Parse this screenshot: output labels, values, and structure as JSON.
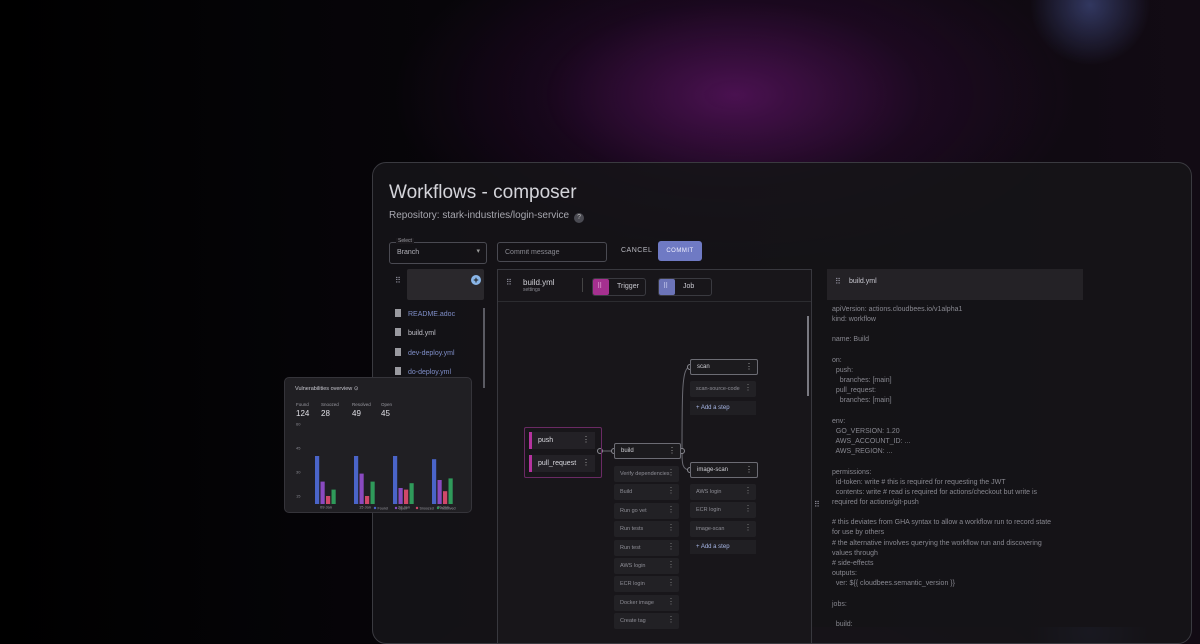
{
  "composer": {
    "title": "Workflows - composer",
    "repository": "Repository: stark-industries/login-service",
    "help_glyph": "?",
    "branch_select": {
      "label": "Select",
      "value": "Branch"
    },
    "commit_input": {
      "placeholder": "Commit message"
    },
    "cancel_label": "CANCEL",
    "commit_label": "COMMIT"
  },
  "file_tree": {
    "files": [
      "README.adoc",
      "build.yml",
      "dev-deploy.yml",
      "do-deploy.yml"
    ]
  },
  "canvas": {
    "file_name": "build.yml",
    "file_sub": "settings",
    "chip_trigger": "Trigger",
    "chip_job": "Job",
    "triggers": [
      "push",
      "pull_request"
    ],
    "build_job": {
      "name": "build",
      "steps": [
        "Verify dependencies",
        "Build",
        "Run go vet",
        "Run tests",
        "Run test",
        "AWS login",
        "ECR login",
        "Docker image",
        "Create tag"
      ]
    },
    "scan_job": {
      "name": "scan",
      "steps": [
        "scan-source-code"
      ],
      "add_step": "+ Add a step"
    },
    "image_job": {
      "name": "image-scan",
      "steps": [
        "AWS login",
        "ECR login",
        "image-scan"
      ],
      "add_step": "+ Add a step"
    }
  },
  "yaml_panel": {
    "file_name": "build.yml",
    "lines": [
      "apiVersion: actions.cloudbees.io/v1alpha1",
      "kind: workflow",
      "",
      "name: Build",
      "",
      "on:",
      "  push:",
      "    branches: [main]",
      "  pull_request:",
      "    branches: [main]",
      "",
      "env:",
      "  GO_VERSION: 1.20",
      "  AWS_ACCOUNT_ID: ...",
      "  AWS_REGION: ...",
      "",
      "permissions:",
      "  id-token: write # this is required for requesting the JWT",
      "  contents: write # read is required for actions/checkout but write is",
      "required for actions/git-push",
      "",
      "# this deviates from GHA syntax to allow a workflow run to record state",
      "for use by others",
      "# the alternative involves querying the workflow run and discovering",
      "values through",
      "# side-effects",
      "outputs:",
      "  ver: ${{ cloudbees.semantic_version }}",
      "",
      "jobs:",
      "",
      "  build:"
    ]
  },
  "vulnerabilities": {
    "title": "Vulnerabilities overview",
    "info_glyph": "⊙",
    "stats": [
      {
        "label": "Found",
        "value": "124"
      },
      {
        "label": "Snoozed",
        "value": "28"
      },
      {
        "label": "Resolved",
        "value": "49"
      },
      {
        "label": "Open",
        "value": "45"
      }
    ]
  },
  "chart_data": {
    "type": "bar",
    "categories": [
      "09 Jan",
      "15 Jan",
      "22 Jan",
      "30 Jan"
    ],
    "series": [
      {
        "name": "Found",
        "color": "#4a64c8",
        "values": [
          40,
          40,
          40,
          38
        ]
      },
      {
        "name": "Open",
        "color": "#8a4ac0",
        "values": [
          24,
          29,
          20,
          25
        ]
      },
      {
        "name": "Snoozed",
        "color": "#d0486a",
        "values": [
          15,
          15,
          19,
          18
        ]
      },
      {
        "name": "Resolved",
        "color": "#2f9a5a",
        "values": [
          19,
          24,
          23,
          26
        ]
      }
    ],
    "yticks": [
      "15",
      "30",
      "45",
      "60"
    ],
    "ylim": [
      10,
      60
    ],
    "title": "Vulnerabilities overview",
    "legend_position": "bottom-right",
    "grid": false
  }
}
